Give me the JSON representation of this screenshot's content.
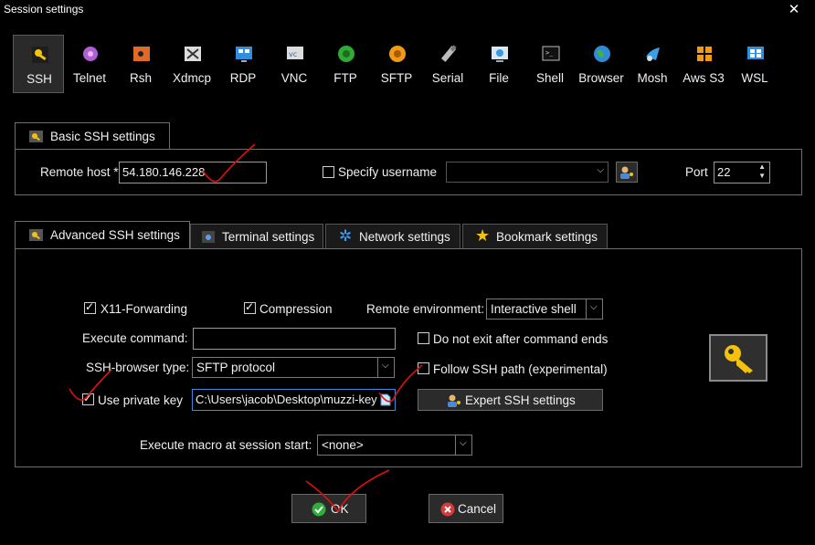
{
  "window": {
    "title": "Session settings",
    "close_glyph": "✕"
  },
  "toolbar": {
    "items": [
      {
        "label": "SSH",
        "icon": "ssh-key-icon",
        "active": true
      },
      {
        "label": "Telnet",
        "icon": "telnet-icon"
      },
      {
        "label": "Rsh",
        "icon": "rsh-icon"
      },
      {
        "label": "Xdmcp",
        "icon": "xdmcp-icon"
      },
      {
        "label": "RDP",
        "icon": "rdp-icon"
      },
      {
        "label": "VNC",
        "icon": "vnc-icon"
      },
      {
        "label": "FTP",
        "icon": "ftp-icon"
      },
      {
        "label": "SFTP",
        "icon": "sftp-icon"
      },
      {
        "label": "Serial",
        "icon": "serial-icon"
      },
      {
        "label": "File",
        "icon": "file-icon"
      },
      {
        "label": "Shell",
        "icon": "shell-icon"
      },
      {
        "label": "Browser",
        "icon": "browser-icon"
      },
      {
        "label": "Mosh",
        "icon": "mosh-icon"
      },
      {
        "label": "Aws S3",
        "icon": "aws-s3-icon"
      },
      {
        "label": "WSL",
        "icon": "wsl-icon"
      }
    ]
  },
  "basic": {
    "tab_label": "Basic SSH settings",
    "remote_host_label": "Remote host *",
    "remote_host_value": "54.180.146.228",
    "specify_username_label": "Specify username",
    "username_value": "",
    "port_label": "Port",
    "port_value": "22"
  },
  "advanced_tabs": {
    "advanced": "Advanced SSH settings",
    "terminal": "Terminal settings",
    "network": "Network settings",
    "bookmark": "Bookmark settings"
  },
  "advanced": {
    "x11_label": "X11-Forwarding",
    "compression_label": "Compression",
    "remote_env_label": "Remote environment:",
    "remote_env_value": "Interactive shell",
    "exec_cmd_label": "Execute command:",
    "exec_cmd_value": "",
    "do_not_exit_label": "Do not exit after command ends",
    "browser_type_label": "SSH-browser type:",
    "browser_type_value": "SFTP protocol",
    "follow_path_label": "Follow SSH path (experimental)",
    "use_key_label": "Use private key",
    "key_path_value": "C:\\Users\\jacob\\Desktop\\muzzi-key",
    "expert_button_label": "Expert SSH settings",
    "macro_label": "Execute macro at session start:",
    "macro_value": "<none>"
  },
  "footer": {
    "ok_label": "OK",
    "cancel_label": "Cancel"
  },
  "colors": {
    "accent": "#3c8de0",
    "annotation": "#e01010",
    "ok_green": "#2fae3b",
    "cancel_red": "#d63a3a"
  }
}
